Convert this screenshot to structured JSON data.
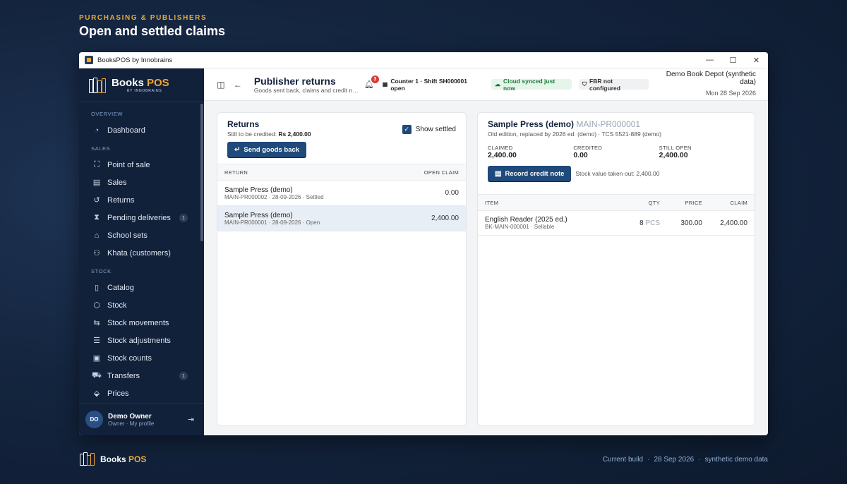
{
  "page": {
    "kicker": "PURCHASING & PUBLISHERS",
    "headline": "Open and settled claims"
  },
  "window": {
    "title": "BooksPOS by Innobrains",
    "controls": [
      "—",
      "☐",
      "✕"
    ]
  },
  "brand": {
    "name_main": "Books",
    "name_accent": " POS",
    "tagline": "BY INNOBRAINS"
  },
  "sidebar": {
    "sections": [
      {
        "label": "OVERVIEW",
        "items": [
          {
            "label": "Dashboard",
            "icon": "gauge-icon"
          }
        ]
      },
      {
        "label": "SALES",
        "items": [
          {
            "label": "Point of sale",
            "icon": "scan-icon"
          },
          {
            "label": "Sales",
            "icon": "receipt-icon"
          },
          {
            "label": "Returns",
            "icon": "return-icon"
          },
          {
            "label": "Pending deliveries",
            "icon": "hourglass-icon",
            "badge": "1"
          },
          {
            "label": "School sets",
            "icon": "school-icon"
          },
          {
            "label": "Khata (customers)",
            "icon": "users-icon"
          }
        ]
      },
      {
        "label": "STOCK",
        "items": [
          {
            "label": "Catalog",
            "icon": "book-icon"
          },
          {
            "label": "Stock",
            "icon": "box-icon"
          },
          {
            "label": "Stock movements",
            "icon": "arrows-icon"
          },
          {
            "label": "Stock adjustments",
            "icon": "sliders-icon"
          },
          {
            "label": "Stock counts",
            "icon": "clipboard-icon"
          },
          {
            "label": "Transfers",
            "icon": "truck-icon",
            "badge": "1"
          },
          {
            "label": "Prices",
            "icon": "tag-icon"
          }
        ]
      }
    ],
    "user": {
      "initials": "DO",
      "name": "Demo Owner",
      "role": "Owner · My profile"
    }
  },
  "topbar": {
    "title": "Publisher returns",
    "subtitle": "Goods sent back, claims and credit notes",
    "notifications": "3",
    "counter": "Counter 1 · Shift SH000001 open",
    "sync": "Cloud synced just now",
    "fbr": "FBR not configured",
    "store_name": "Demo Book Depot (synthetic data)",
    "date": "Mon 28 Sep 2026"
  },
  "returns_panel": {
    "title": "Returns",
    "credit_label": "Still to be credited:",
    "credit_value": "Rs 2,400.00",
    "send_button": "Send goods back",
    "show_settled": "Show settled",
    "columns": [
      "RETURN",
      "OPEN CLAIM"
    ],
    "rows": [
      {
        "publisher": "Sample Press (demo)",
        "meta": "MAIN-PR000002 · 28-09-2026 · Settled",
        "claim": "0.00"
      },
      {
        "publisher": "Sample Press (demo)",
        "meta": "MAIN-PR000001 · 28-09-2026 · Open",
        "claim": "2,400.00"
      }
    ]
  },
  "detail_panel": {
    "publisher": "Sample Press (demo)",
    "code": "MAIN-PR000001",
    "note": "Old edition, replaced by 2026 ed. (demo) · TCS 5521-889 (demo)",
    "stats": [
      {
        "label": "CLAIMED",
        "value": "2,400.00"
      },
      {
        "label": "CREDITED",
        "value": "0.00"
      },
      {
        "label": "STILL OPEN",
        "value": "2,400.00"
      }
    ],
    "record_button": "Record credit note",
    "stock_note": "Stock value taken out: 2,400.00",
    "columns": {
      "item": "ITEM",
      "qty": "QTY",
      "price": "PRICE",
      "claim": "CLAIM"
    },
    "items": [
      {
        "name": "English Reader (2025 ed.)",
        "meta": "BK-MAIN-000001 · Sellable",
        "qty": "8",
        "unit": "PCS",
        "price": "300.00",
        "claim": "2,400.00"
      }
    ]
  },
  "footer": {
    "build_label": "Current build",
    "build_date": "28 Sep 2026",
    "data_note": "synthetic demo data",
    "sep": "·"
  }
}
